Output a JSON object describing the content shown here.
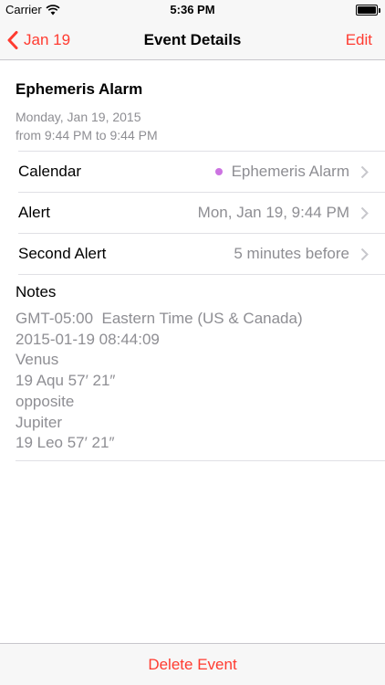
{
  "status_bar": {
    "carrier": "Carrier",
    "time": "5:36 PM",
    "battery_level": 1.0
  },
  "nav": {
    "back_label": "Jan 19",
    "title": "Event Details",
    "edit_label": "Edit",
    "accent_color": "#ff3b30"
  },
  "event": {
    "title": "Ephemeris Alarm",
    "date": "Monday, Jan 19, 2015",
    "time_range": "from 9:44 PM to 9:44 PM"
  },
  "rows": [
    {
      "label": "Calendar",
      "value": "Ephemeris Alarm",
      "dot_color": "#cc73e1"
    },
    {
      "label": "Alert",
      "value": "Mon, Jan 19, 9:44 PM"
    },
    {
      "label": "Second Alert",
      "value": "5 minutes before"
    }
  ],
  "notes": {
    "title": "Notes",
    "body": "GMT-05:00  Eastern Time (US & Canada)\n2015-01-19 08:44:09\nVenus\n19 Aqu 57′ 21″\nopposite\nJupiter\n19 Leo 57′ 21″"
  },
  "footer": {
    "delete_label": "Delete Event"
  },
  "icons": {
    "back": "chevron-left-icon",
    "row_chevron": "chevron-right-icon",
    "wifi": "wifi-icon",
    "battery": "battery-icon"
  }
}
